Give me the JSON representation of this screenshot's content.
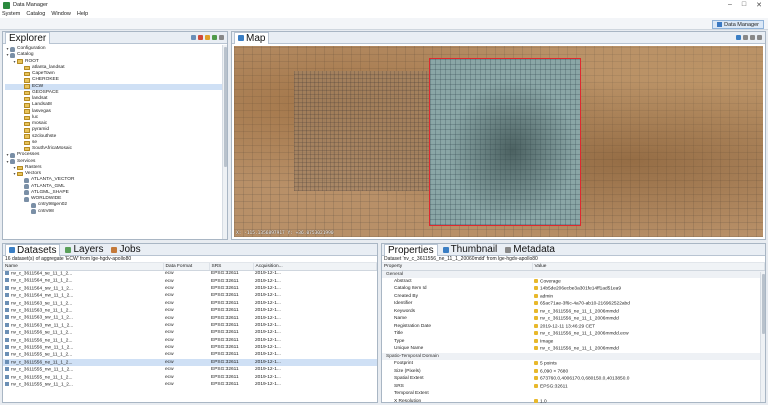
{
  "window": {
    "title": "Data Manager"
  },
  "menu": [
    "System",
    "Catalog",
    "Window",
    "Help"
  ],
  "perspective": {
    "label": "Data Manager"
  },
  "explorer": {
    "title": "Explorer",
    "tree": [
      {
        "label": "Configuration",
        "level": 0,
        "icon": "gear"
      },
      {
        "label": "Catalog",
        "level": 0,
        "icon": "db"
      },
      {
        "label": "ROOT",
        "level": 1,
        "icon": "folder"
      },
      {
        "label": "atlanta_landsat",
        "level": 2,
        "icon": "folder"
      },
      {
        "label": "CapeTown",
        "level": 2,
        "icon": "folder"
      },
      {
        "label": "CHEROKEE",
        "level": 2,
        "icon": "folder"
      },
      {
        "label": "ECW",
        "level": 2,
        "icon": "folder",
        "selected": true
      },
      {
        "label": "GEOSPACE",
        "level": 2,
        "icon": "folder"
      },
      {
        "label": "landsat",
        "level": 2,
        "icon": "folder"
      },
      {
        "label": "Landsat8",
        "level": 2,
        "icon": "folder"
      },
      {
        "label": "lasvegas",
        "level": 2,
        "icon": "folder"
      },
      {
        "label": "luc",
        "level": 2,
        "icon": "folder"
      },
      {
        "label": "mosaic",
        "level": 2,
        "icon": "folder"
      },
      {
        "label": "pyramid",
        "level": 2,
        "icon": "folder"
      },
      {
        "label": "s2clouthste",
        "level": 2,
        "icon": "folder"
      },
      {
        "label": "se",
        "level": 2,
        "icon": "folder"
      },
      {
        "label": "SouthAfricaMosaic",
        "level": 2,
        "icon": "folder"
      },
      {
        "label": "Processes",
        "level": 0,
        "icon": "db"
      },
      {
        "label": "Services",
        "level": 0,
        "icon": "db"
      },
      {
        "label": "Rasters",
        "level": 1,
        "icon": "folder"
      },
      {
        "label": "Vectors",
        "level": 1,
        "icon": "folder"
      },
      {
        "label": "ATLANTA_VECTOR",
        "level": 2,
        "icon": "db"
      },
      {
        "label": "ATLANTA_GML",
        "level": 2,
        "icon": "db"
      },
      {
        "label": "ATLGML_SHAPE",
        "level": 2,
        "icon": "db"
      },
      {
        "label": "WORLDWIDE",
        "level": 2,
        "icon": "db"
      },
      {
        "label": "cntry98gen02",
        "level": 3,
        "icon": "db"
      },
      {
        "label": "cntrv98",
        "level": 3,
        "icon": "db"
      }
    ]
  },
  "map": {
    "title": "Map",
    "coords": "X: -115.1356897917 Y: +36.0753021990"
  },
  "bottom_left": {
    "tabs": [
      "Datasets",
      "Layers",
      "Jobs"
    ],
    "summary": "16 dataset(s) of aggregate 'ECW' from lge-hgdv-apollo80",
    "columns": [
      "Name",
      "Data Format",
      "SRS",
      "Acquisition..."
    ],
    "rows": [
      {
        "name": "nv_c_3611564_se_11_1_2...",
        "format": "ecw",
        "srs": "EPSG:32611",
        "acq": "2019-12-1..."
      },
      {
        "name": "nv_c_3611564_ne_11_1_2...",
        "format": "ecw",
        "srs": "EPSG:32611",
        "acq": "2019-12-1..."
      },
      {
        "name": "nv_c_3611564_sw_11_1_2...",
        "format": "ecw",
        "srs": "EPSG:32611",
        "acq": "2019-12-1..."
      },
      {
        "name": "nv_c_3611564_nw_11_1_2...",
        "format": "ecw",
        "srs": "EPSG:32611",
        "acq": "2019-12-1..."
      },
      {
        "name": "nv_c_3611563_se_11_1_2...",
        "format": "ecw",
        "srs": "EPSG:32611",
        "acq": "2019-12-1..."
      },
      {
        "name": "nv_c_3611563_ne_11_1_2...",
        "format": "ecw",
        "srs": "EPSG:32611",
        "acq": "2019-12-1..."
      },
      {
        "name": "nv_c_3611563_sw_11_1_2...",
        "format": "ecw",
        "srs": "EPSG:32611",
        "acq": "2019-12-1..."
      },
      {
        "name": "nv_c_3611563_nw_11_1_2...",
        "format": "ecw",
        "srs": "EPSG:32611",
        "acq": "2019-12-1..."
      },
      {
        "name": "nv_c_3611556_se_11_1_2...",
        "format": "ecw",
        "srs": "EPSG:32611",
        "acq": "2019-12-1..."
      },
      {
        "name": "nv_c_3611556_ne_11_1_2...",
        "format": "ecw",
        "srs": "EPSG:32611",
        "acq": "2019-12-1..."
      },
      {
        "name": "nv_c_3611556_nw_11_1_2...",
        "format": "ecw",
        "srs": "EPSG:32611",
        "acq": "2019-12-1..."
      },
      {
        "name": "nv_c_3611555_se_11_1_2...",
        "format": "ecw",
        "srs": "EPSG:32611",
        "acq": "2019-12-1..."
      },
      {
        "name": "nv_c_3611556_ne_11_1_2...",
        "format": "ecw",
        "srs": "EPSG:32611",
        "acq": "2019-12-1...",
        "selected": true
      },
      {
        "name": "nv_c_3611555_nw_11_1_2...",
        "format": "ecw",
        "srs": "EPSG:32611",
        "acq": "2019-12-1..."
      },
      {
        "name": "nv_c_3611555_ne_11_1_2...",
        "format": "ecw",
        "srs": "EPSG:32611",
        "acq": "2019-12-1..."
      },
      {
        "name": "nv_c_3611555_sw_11_1_2...",
        "format": "ecw",
        "srs": "EPSG:32611",
        "acq": "2019-12-1..."
      }
    ]
  },
  "bottom_right": {
    "tabs": [
      "Properties",
      "Thumbnail",
      "Metadata"
    ],
    "summary": "Dataset 'nv_c_3611556_ne_11_1_20060mdd' from lge-hgdv-apollo80",
    "columns": [
      "Property",
      "Value"
    ],
    "rows": [
      {
        "group": true,
        "prop": "General",
        "value": ""
      },
      {
        "prop": "Abstract",
        "value": "Coverage"
      },
      {
        "prop": "Catalog Item Id",
        "value": "14b5de206ecbe3a301fe14ff1ad51ea9"
      },
      {
        "prop": "Created By",
        "value": "admin"
      },
      {
        "prop": "Identifier",
        "value": "65ac71ae-3f6c-4a70-ab10-216962522abd"
      },
      {
        "prop": "Keywords",
        "value": "nv_c_3611556_ne_11_1_2006mmdd"
      },
      {
        "prop": "Name",
        "value": "nv_c_3611556_ne_11_1_2006mmdd"
      },
      {
        "prop": "Registration Date",
        "value": "2019-12-11 13:46:29 CET"
      },
      {
        "prop": "Title",
        "value": "nv_c_3611556_ne_11_1_2006mmdd.ecw"
      },
      {
        "prop": "Type",
        "value": "Image"
      },
      {
        "prop": "Unique Name",
        "value": "nv_c_3611556_ne_11_1_2006mmdd"
      },
      {
        "group": true,
        "prop": "Spatio-Temporal Domain",
        "value": ""
      },
      {
        "prop": "Footprint",
        "value": "5 points"
      },
      {
        "prop": "Size (Pixels)",
        "value": "6,090 × 7680"
      },
      {
        "prop": "Spatial Extent",
        "value": "673760.0,4006170.0,680150.0,4013850.0"
      },
      {
        "prop": "SRS",
        "value": "EPSG:32611"
      },
      {
        "prop": "Temporal Extent",
        "value": ""
      },
      {
        "prop": "X Resolution",
        "value": "1.0"
      }
    ]
  }
}
